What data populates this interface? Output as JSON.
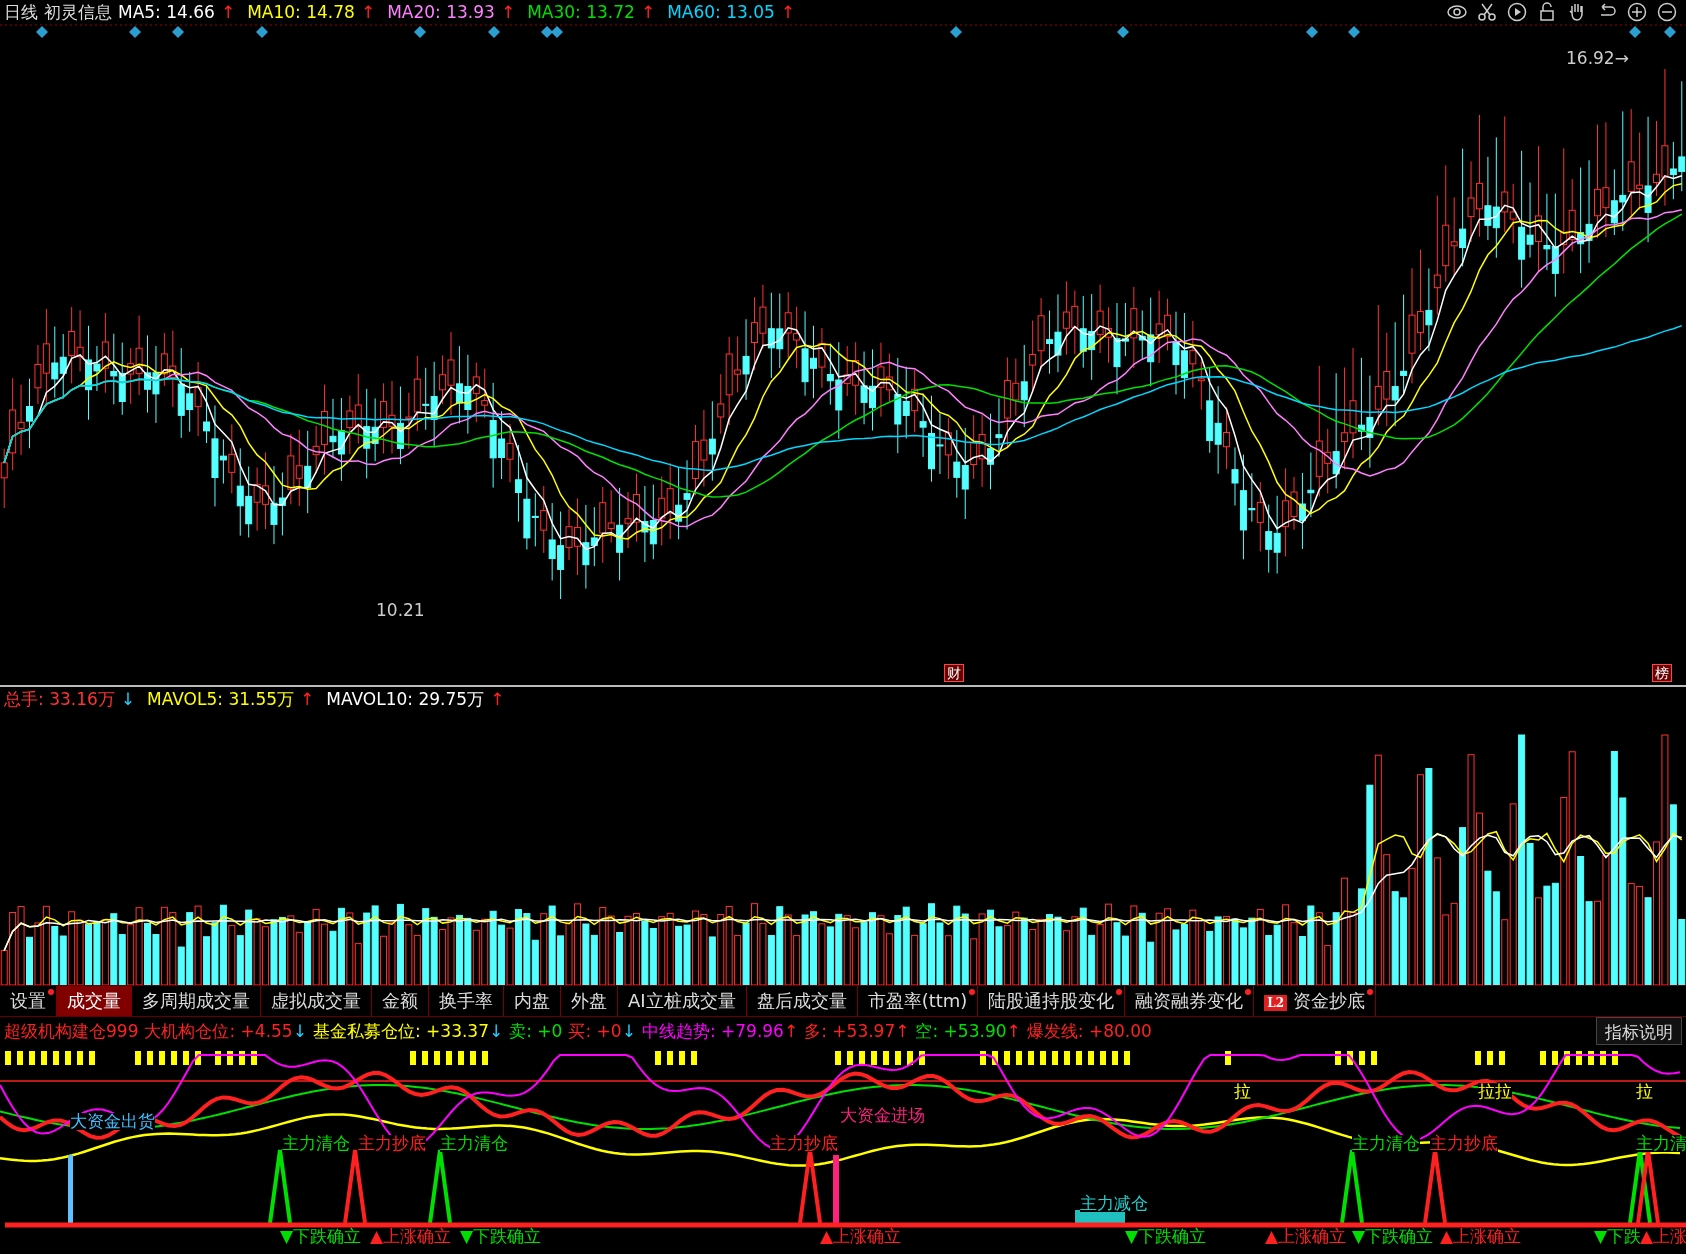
{
  "header": {
    "period": "日线",
    "stock": "初灵信息",
    "items": [
      {
        "label": "MA5: 14.66",
        "color": "#ffffff",
        "arrow": "↑",
        "rising": true
      },
      {
        "label": "MA10: 14.78",
        "color": "#ffff00",
        "arrow": "↑",
        "rising": true
      },
      {
        "label": "MA20: 13.93",
        "color": "#ff80ff",
        "arrow": "↑",
        "rising": true
      },
      {
        "label": "MA30: 13.72",
        "color": "#00e000",
        "arrow": "↑",
        "rising": true
      },
      {
        "label": "MA60: 13.05",
        "color": "#00d8ff",
        "arrow": "↑",
        "rising": true
      }
    ]
  },
  "price_chart": {
    "high_label": "16.92→",
    "low_label": "10.21",
    "markers": [
      "财",
      "榜"
    ]
  },
  "volume": {
    "items": [
      {
        "label": "总手: 33.16万",
        "color": "#ff3333",
        "arrow": "↓",
        "rising": false
      },
      {
        "label": "MAVOL5: 31.55万",
        "color": "#ffff00",
        "arrow": "↑",
        "rising": true
      },
      {
        "label": "MAVOL10: 29.75万",
        "color": "#ffffff",
        "arrow": "↑",
        "rising": true
      }
    ]
  },
  "tabs": [
    {
      "label": "设置",
      "selected": false,
      "dot": true
    },
    {
      "label": "成交量",
      "selected": true,
      "dot": false
    },
    {
      "label": "多周期成交量",
      "selected": false,
      "dot": false
    },
    {
      "label": "虚拟成交量",
      "selected": false,
      "dot": false
    },
    {
      "label": "金额",
      "selected": false,
      "dot": false
    },
    {
      "label": "换手率",
      "selected": false,
      "dot": false
    },
    {
      "label": "内盘",
      "selected": false,
      "dot": false
    },
    {
      "label": "外盘",
      "selected": false,
      "dot": false
    },
    {
      "label": "AI立桩成交量",
      "selected": false,
      "dot": false
    },
    {
      "label": "盘后成交量",
      "selected": false,
      "dot": false
    },
    {
      "label": "市盈率(ttm)",
      "selected": false,
      "dot": true
    },
    {
      "label": "陆股通持股变化",
      "selected": false,
      "dot": true
    },
    {
      "label": "融资融券变化",
      "selected": false,
      "dot": true
    },
    {
      "label": "资金抄底",
      "selected": false,
      "dot": true,
      "badge": "L2"
    }
  ],
  "indicator": {
    "items": [
      {
        "label": "超级机构建仓999",
        "color": "#ff2020"
      },
      {
        "label": "大机构仓位: +4.55",
        "color": "#ff2020",
        "arrow": "↓",
        "rising": false
      },
      {
        "label": "基金私募仓位: +33.37",
        "color": "#ffff00",
        "arrow": "↓",
        "rising": false
      },
      {
        "label": "卖: +0",
        "color": "#00e000"
      },
      {
        "label": "买: +0",
        "color": "#ff2020",
        "arrow": "↓",
        "rising": false
      },
      {
        "label": "中线趋势: +79.96",
        "color": "#ff00ff",
        "arrow": "↑",
        "rising": true
      },
      {
        "label": "多: +53.97",
        "color": "#ff2020",
        "arrow": "↑",
        "rising": true
      },
      {
        "label": "空: +53.90",
        "color": "#00e000",
        "arrow": "↑",
        "rising": true
      },
      {
        "label": "爆发线: +80.00",
        "color": "#ff2020"
      }
    ],
    "help_button": "指标说明",
    "signals": [
      {
        "text": "大资金出货",
        "color": "#40c0ff"
      },
      {
        "text": "主力清仓",
        "color": "#00e000"
      },
      {
        "text": "主力抄底",
        "color": "#ff2020"
      },
      {
        "text": "主力清仓",
        "color": "#00e000"
      },
      {
        "text": "主力抄底",
        "color": "#ff2020"
      },
      {
        "text": "大资金进场",
        "color": "#ff2080"
      },
      {
        "text": "主力减仓",
        "color": "#20d0d0"
      },
      {
        "text": "主力清仓",
        "color": "#00e000"
      },
      {
        "text": "主力抄底",
        "color": "#ff2020"
      },
      {
        "text": "主力清",
        "color": "#00e000"
      },
      {
        "text": "拉",
        "color": "#ffff00"
      },
      {
        "text": "拉拉",
        "color": "#ffff00"
      },
      {
        "text": "拉",
        "color": "#ffff00"
      }
    ],
    "trend_labels": [
      {
        "text": "▼下跌确立",
        "kind": "down"
      },
      {
        "text": "▲上涨确立",
        "kind": "up"
      },
      {
        "text": "▼下跌确立",
        "kind": "down"
      },
      {
        "text": "▲上涨确立",
        "kind": "up"
      },
      {
        "text": "▼下跌确立",
        "kind": "down"
      },
      {
        "text": "▲上涨确立",
        "kind": "up"
      },
      {
        "text": "▼下跌确立",
        "kind": "down"
      },
      {
        "text": "▲上涨确立",
        "kind": "up"
      },
      {
        "text": "▼下跌",
        "kind": "down"
      },
      {
        "text": "▲上涨",
        "kind": "up"
      }
    ]
  }
}
